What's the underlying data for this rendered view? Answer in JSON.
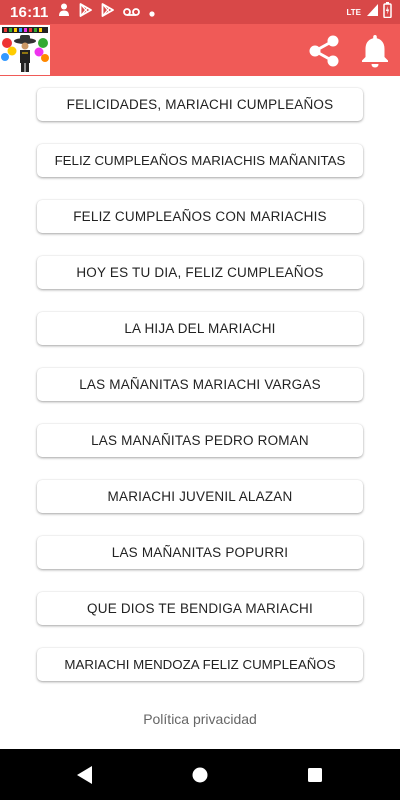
{
  "status_bar": {
    "time": "16:11",
    "network": "LTE",
    "icons": [
      "person-icon",
      "play-store-icon",
      "play-store-icon",
      "voicemail-icon",
      "dot-icon",
      "signal-icon",
      "battery-charging-icon"
    ]
  },
  "app_bar": {
    "background": "#f05a57",
    "logo_icon": "mariachi-logo",
    "actions": [
      "share-icon",
      "bell-icon"
    ]
  },
  "songs": [
    "FELICIDADES, MARIACHI CUMPLEAÑOS",
    "FELIZ CUMPLEAÑOS MARIACHIS MAÑANITAS",
    "FELIZ CUMPLEAÑOS CON MARIACHIS",
    "HOY ES TU DIA, FELIZ CUMPLEAÑOS",
    "LA HIJA DEL MARIACHI",
    "LAS MAÑANITAS MARIACHI VARGAS",
    "LAS MANAÑITAS PEDRO ROMAN",
    "MARIACHI JUVENIL ALAZAN",
    "LAS MAÑANITAS POPURRI",
    "QUE DIOS TE BENDIGA MARIACHI",
    "MARIACHI MENDOZA FELIZ CUMPLEAÑOS"
  ],
  "footer": {
    "privacy_label": "Política privacidad"
  },
  "nav_bar": {
    "icons": [
      "back-icon",
      "home-icon",
      "recents-icon"
    ]
  }
}
